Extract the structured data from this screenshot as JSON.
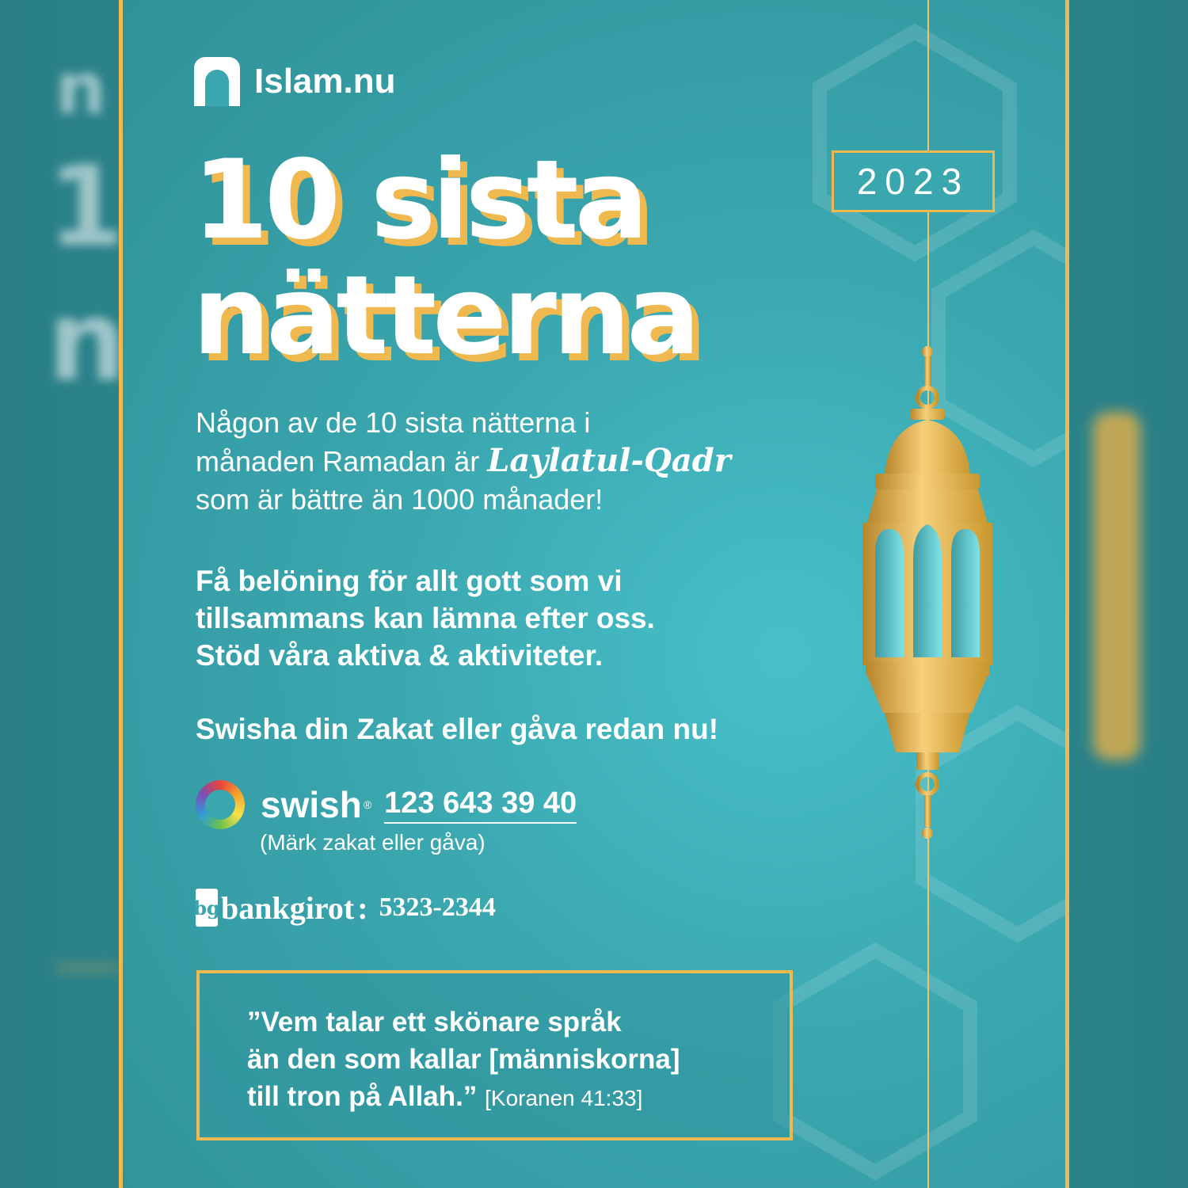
{
  "brand": {
    "name": "Islam.nu"
  },
  "year": "2023",
  "headline": {
    "line1": "10 sista",
    "line2": "nätterna"
  },
  "intro": {
    "line1": "Någon av de 10 sista nätterna i",
    "line2_pre": "månaden Ramadan är ",
    "line2_script": "Laylatul-Qadr",
    "line3": "som är bättre än 1000 månader!"
  },
  "reward": {
    "line1": "Få belöning för allt gott som vi",
    "line2": "tillsammans kan lämna efter oss.",
    "line3": "Stöd våra aktiva & aktiviteter."
  },
  "cta": "Swisha din Zakat eller gåva redan nu!",
  "swish": {
    "word": "swish",
    "registered": "®",
    "number": "123 643 39 40",
    "note": "(Märk zakat eller gåva)"
  },
  "bankgiro": {
    "mark": "bg",
    "word": "bankgirot",
    "colon": ":",
    "number": "5323-2344"
  },
  "quote": {
    "line1": "”Vem talar ett skönare språk",
    "line2": "än den som kallar [människorna]",
    "line3": "till tron på Allah.”",
    "source": "[Koranen 41:33]"
  },
  "colors": {
    "teal": "#3aa6ae",
    "gold": "#f0b94f",
    "white": "#ffffff"
  },
  "icons": [
    "islam-nu-logo-icon",
    "swish-logo-icon",
    "bankgirot-logo-icon",
    "lantern-icon"
  ]
}
